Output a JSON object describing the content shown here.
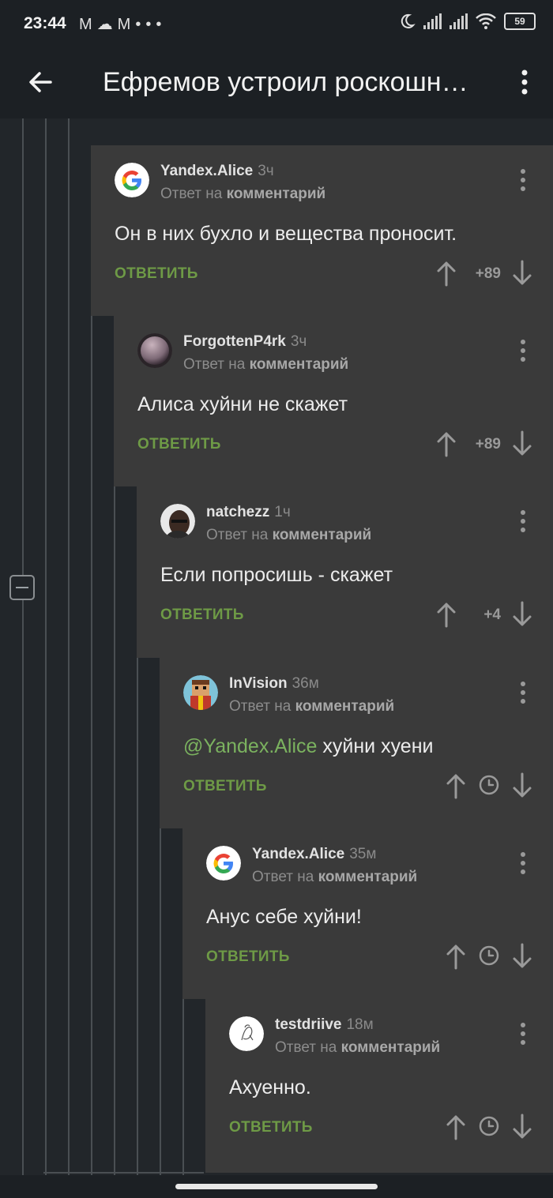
{
  "status_bar": {
    "time": "23:44",
    "left_icons": [
      "gmail-icon",
      "cloud-icon",
      "gmail-icon",
      "more-dots-icon"
    ],
    "battery": "59",
    "right_icons": [
      "moon-icon",
      "signal-icon",
      "signal-icon",
      "wifi-icon",
      "battery-icon"
    ]
  },
  "app_bar": {
    "title": "Ефремов устроил роскошн…",
    "back_icon": "arrow-left-icon",
    "menu_icon": "more-vert-icon"
  },
  "comments": [
    {
      "author": "Yandex.Alice",
      "time": "3ч",
      "reply_prefix": "Ответ на",
      "reply_target": "комментарий",
      "text": "Он в них бухло и вещества проносит.",
      "reply_label": "ОТВЕТИТЬ",
      "score": "+89",
      "avatar": "google-logo"
    },
    {
      "author": "ForgottenP4rk",
      "time": "3ч",
      "reply_prefix": "Ответ на",
      "reply_target": "комментарий",
      "text": "Алиса хуйни не скажет",
      "reply_label": "ОТВЕТИТЬ",
      "score": "+89",
      "avatar": "sphere-photo"
    },
    {
      "author": "natchezz",
      "time": "1ч",
      "reply_prefix": "Ответ на",
      "reply_target": "комментарий",
      "text": "Если попросишь - скажет",
      "reply_label": "ОТВЕТИТЬ",
      "score": "+4",
      "avatar": "person-photo"
    },
    {
      "author": "InVision",
      "time": "36м",
      "reply_prefix": "Ответ на",
      "reply_target": "комментарий",
      "mention": "@Yandex.Alice",
      "text": " хуйни хуени",
      "reply_label": "ОТВЕТИТЬ",
      "score": "",
      "avatar": "pixel-character"
    },
    {
      "author": "Yandex.Alice",
      "time": "35м",
      "reply_prefix": "Ответ на",
      "reply_target": "комментарий",
      "text": "Анус себе хуйни!",
      "reply_label": "ОТВЕТИТЬ",
      "score": "",
      "avatar": "google-logo"
    },
    {
      "author": "testdriive",
      "time": "18м",
      "reply_prefix": "Ответ на",
      "reply_target": "комментарий",
      "text": "Ахуенно.",
      "reply_label": "ОТВЕТИТЬ",
      "score": "",
      "avatar": "sketch-drawing"
    }
  ],
  "colors": {
    "background": "#22262a",
    "comment_bg": "#3a3a3a",
    "reply_green": "#6e9a46",
    "mention_green": "#7bb25f"
  }
}
